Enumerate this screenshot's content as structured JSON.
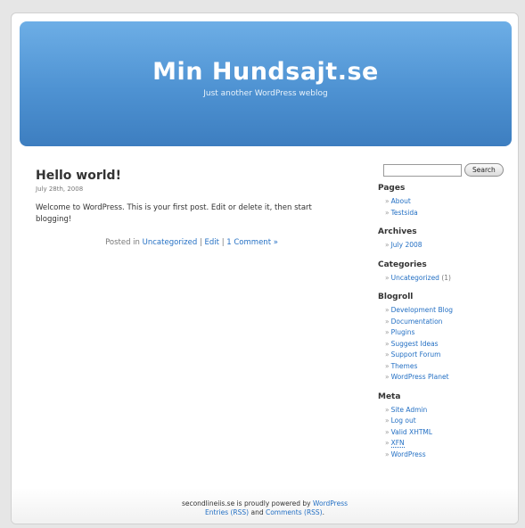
{
  "header": {
    "title": "Min Hundsajt.se",
    "description": "Just another WordPress weblog"
  },
  "post": {
    "title": "Hello world!",
    "date": "July 28th, 2008",
    "body": "Welcome to WordPress. This is your first post. Edit or delete it, then start blogging!",
    "posted_in_label": "Posted in",
    "category_link": "Uncategorized",
    "separator": "|",
    "edit_link": "Edit",
    "comments_link": "1 Comment »"
  },
  "search": {
    "placeholder": "",
    "value": "",
    "button_label": "Search"
  },
  "sidebar": {
    "pages": {
      "heading": "Pages",
      "items": [
        "About",
        "Testsida"
      ]
    },
    "archives": {
      "heading": "Archives",
      "items": [
        "July 2008"
      ]
    },
    "categories": {
      "heading": "Categories",
      "items": [
        {
          "label": "Uncategorized",
          "count": "(1)"
        }
      ]
    },
    "blogroll": {
      "heading": "Blogroll",
      "items": [
        "Development Blog",
        "Documentation",
        "Plugins",
        "Suggest Ideas",
        "Support Forum",
        "Themes",
        "WordPress Planet"
      ]
    },
    "meta": {
      "heading": "Meta",
      "items": [
        "Site Admin",
        "Log out",
        "Valid XHTML",
        "XFN",
        "WordPress"
      ]
    },
    "bullet": "»"
  },
  "footer": {
    "text1": "secondlineiis.se is proudly powered by",
    "wordpress_link": "WordPress",
    "entries_rss": "Entries (RSS)",
    "and_text": "and",
    "comments_rss": "Comments (RSS)",
    "period": "."
  },
  "colors": {
    "header_top": "#6daee6",
    "header_bottom": "#3d7ec0",
    "link": "#2470c4"
  }
}
